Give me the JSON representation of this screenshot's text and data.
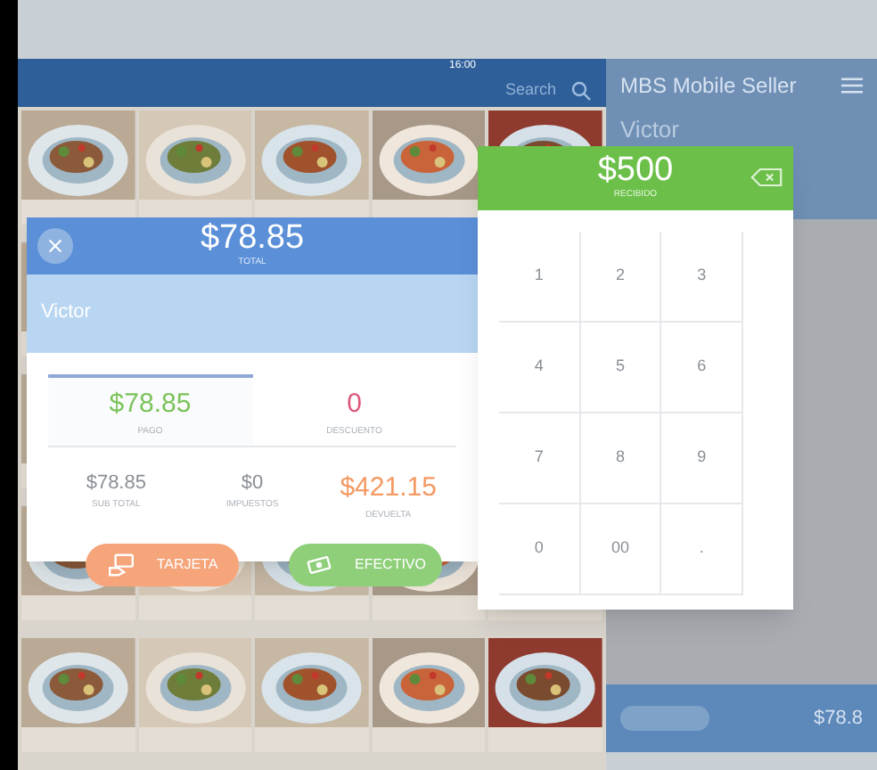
{
  "app": {
    "status_time": "16:00",
    "search": {
      "placeholder": "Search"
    },
    "title": "MBS Mobile Seller",
    "customer": "Victor",
    "footer_total": "$78.8"
  },
  "payment": {
    "total": "$78.85",
    "total_label": "TOTAL",
    "customer": "Victor",
    "summary": [
      {
        "value": "$78.85",
        "label": "PAGO",
        "kind": "paid",
        "selected": true
      },
      {
        "value": "0",
        "label": "DESCUENTO",
        "kind": "discount",
        "selected": false
      }
    ],
    "totals": [
      {
        "value": "$78.85",
        "label": "SUB TOTAL",
        "kind": "neutral"
      },
      {
        "value": "$0",
        "label": "IMPUESTOS",
        "kind": "neutral"
      },
      {
        "value": "$421.15",
        "label": "DEVUELTA",
        "kind": "change"
      }
    ],
    "methods": [
      {
        "label": "TARJETA",
        "kind": "card"
      },
      {
        "label": "EFECTIVO",
        "kind": "cash"
      }
    ]
  },
  "keypad": {
    "amount": "$500",
    "amount_label": "RECIBIDO",
    "keys": [
      "1",
      "2",
      "3",
      "4",
      "5",
      "6",
      "7",
      "8",
      "9",
      "0",
      "00",
      "."
    ]
  }
}
